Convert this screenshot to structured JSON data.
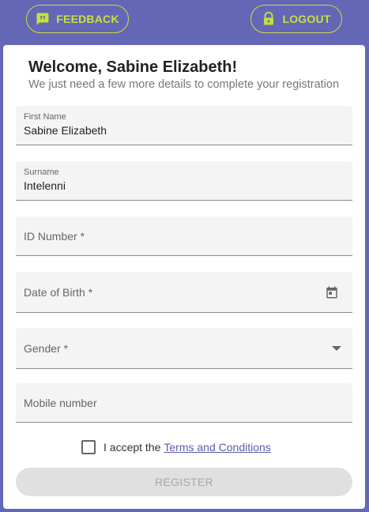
{
  "header": {
    "feedback_label": "FEEDBACK",
    "logout_label": "LOGOUT"
  },
  "form": {
    "title": "Welcome, Sabine Elizabeth!",
    "subtitle": "We just need a few more details to complete your registration",
    "first_name": {
      "label": "First Name",
      "value": "Sabine Elizabeth"
    },
    "surname": {
      "label": "Surname",
      "value": "Intelenni"
    },
    "id_number": {
      "placeholder": "ID Number *"
    },
    "dob": {
      "placeholder": "Date of Birth *"
    },
    "gender": {
      "placeholder": "Gender *"
    },
    "mobile": {
      "placeholder": "Mobile number"
    },
    "terms_prefix": "I accept the",
    "terms_link": "Terms and Conditions",
    "register_label": "REGISTER"
  },
  "colors": {
    "background": "#6467b6",
    "accent": "#c6e23a",
    "link": "#5b5cb0"
  },
  "icons": {
    "feedback": "feedback-icon",
    "logout": "lock-icon",
    "dob": "calendar-icon",
    "gender": "dropdown-arrow-icon"
  }
}
